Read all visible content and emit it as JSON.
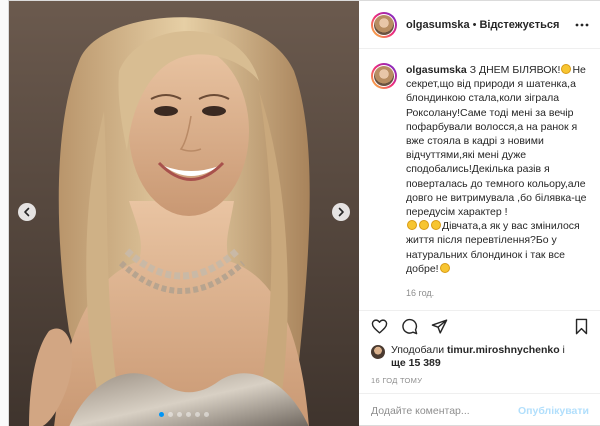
{
  "post": {
    "author": {
      "username": "olgasumska",
      "follow_state": "Відстежується"
    },
    "media": {
      "slide_count": 6,
      "active_slide": 1
    },
    "caption": {
      "username": "olgasumska",
      "text_1": "З ДНЕМ БІЛЯВОК!",
      "text_2": "Не секрет,що від природи я шатенка,а блондинкою стала,коли зіграла Роксолану!Саме тоді мені за вечір пофарбували волосся,а на ранок я вже стояла в кадрі з новими відчуттями,які мені дуже сподобались!Декілька разів я поверталась до темного кольору,але довго не витримувала ,бо білявка-це передусім характер !",
      "text_3": "Дівчата,а як у вас змінилося життя після перевтілення?Бо у натуральних блондинок і так все добре!",
      "time": "16 год."
    },
    "likes": {
      "prefix": "Уподобали",
      "liker": "timur.miroshnychenko",
      "conjunction": "і",
      "rest": "ще 15 389"
    },
    "time_ago": "16 год тому",
    "comment_box": {
      "placeholder": "Додайте коментар...",
      "publish_label": "Опублікувати"
    }
  },
  "icons": {
    "more": "more-horizontal-icon",
    "like": "heart-icon",
    "comment": "comment-icon",
    "share": "paper-plane-icon",
    "save": "bookmark-icon",
    "load_more": "plus-circle-icon",
    "prev": "chevron-left-icon",
    "next": "chevron-right-icon"
  },
  "colors": {
    "accent": "#0095f6",
    "publish_disabled": "#b2dffc",
    "muted_text": "#8e8e8e",
    "border": "#dbdbdb"
  }
}
